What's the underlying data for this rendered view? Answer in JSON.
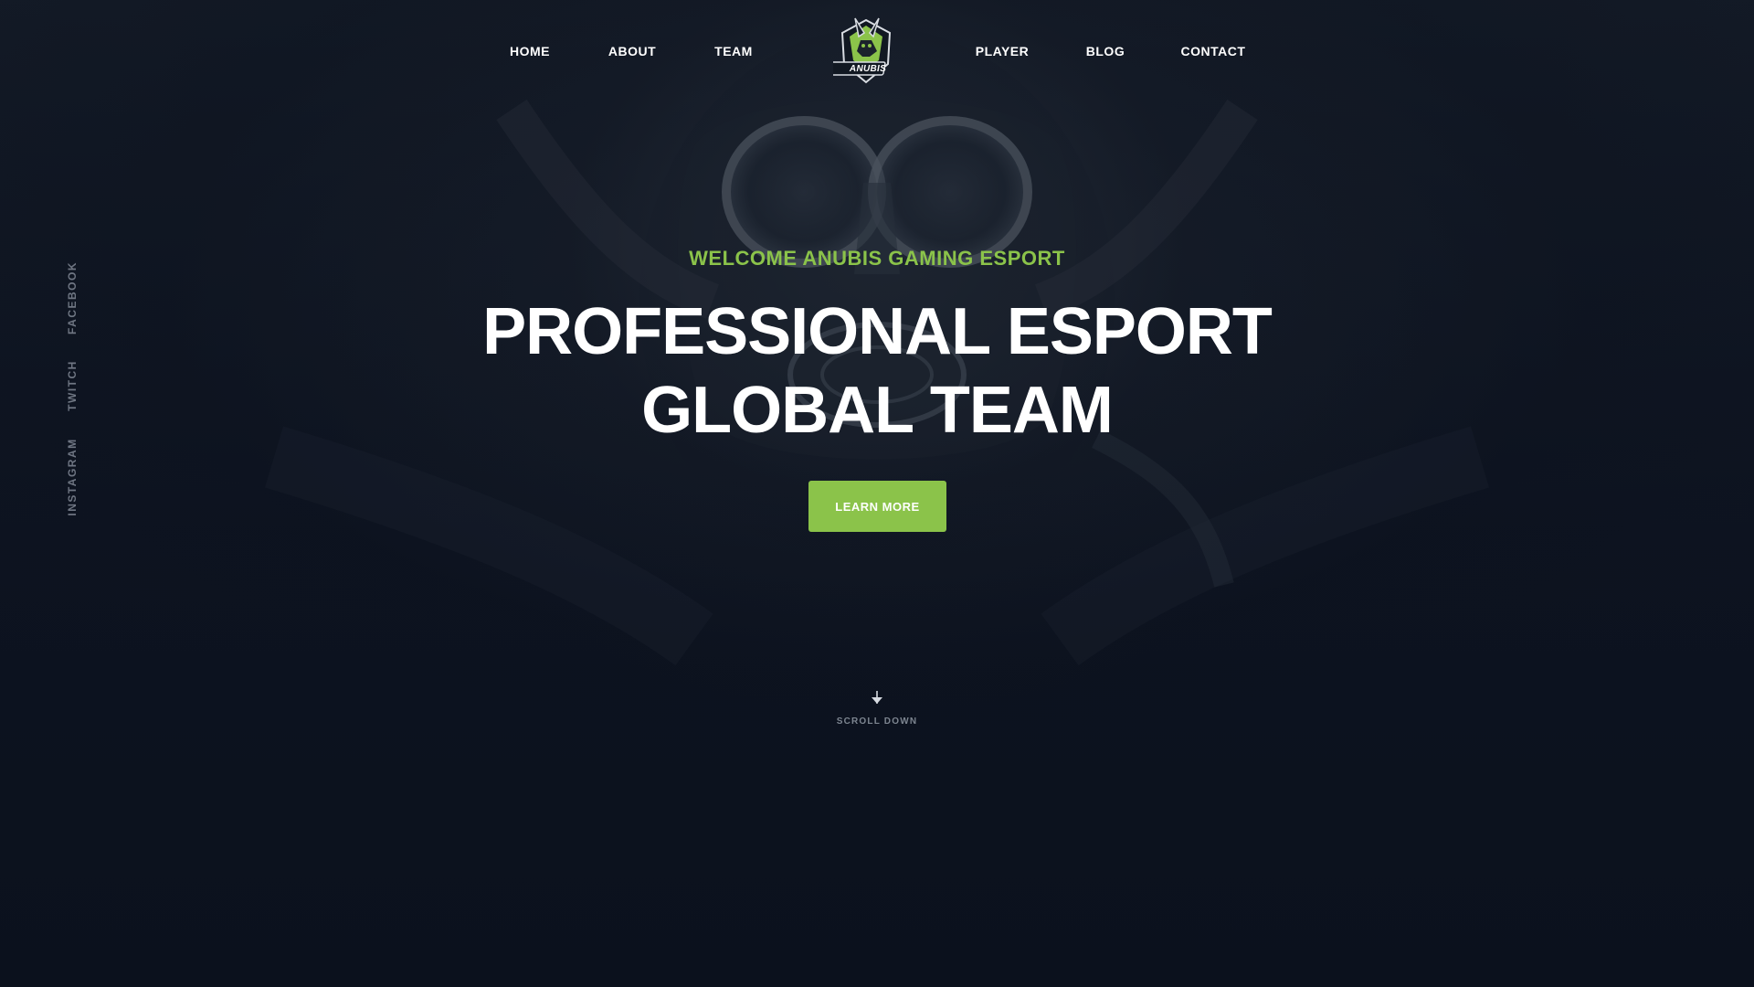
{
  "nav": {
    "left_items": [
      {
        "label": "HOME"
      },
      {
        "label": "ABOUT"
      },
      {
        "label": "TEAM"
      }
    ],
    "right_items": [
      {
        "label": "PLAYER"
      },
      {
        "label": "BLOG"
      },
      {
        "label": "CONTACT"
      }
    ],
    "logo": {
      "text": "ANUBIS",
      "icon": "anubis-logo-icon"
    }
  },
  "social": [
    {
      "label": "FACEBOOK"
    },
    {
      "label": "TWITCH"
    },
    {
      "label": "INSTAGRAM"
    }
  ],
  "hero": {
    "eyebrow": "WELCOME ANUBIS GAMING ESPORT",
    "headline_line1": "PROFESSIONAL ESPORT",
    "headline_line2": "GLOBAL TEAM",
    "cta_label": "LEARN MORE"
  },
  "scroll": {
    "label": "SCROLL DOWN",
    "icon": "arrow-down-icon"
  },
  "colors": {
    "accent": "#8bc34a",
    "background": "#0b111d",
    "text": "#ffffff",
    "muted": "#6f7683"
  }
}
